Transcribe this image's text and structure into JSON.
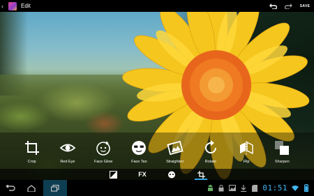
{
  "header": {
    "title": "Edit",
    "save_label": "SAVE"
  },
  "tools": [
    {
      "label": "Crop",
      "icon": "crop-icon"
    },
    {
      "label": "Red Eye",
      "icon": "eye-icon"
    },
    {
      "label": "Face Glow",
      "icon": "face-glow-icon"
    },
    {
      "label": "Face Tan",
      "icon": "face-tan-icon"
    },
    {
      "label": "Straighten",
      "icon": "straighten-icon"
    },
    {
      "label": "Rotate",
      "icon": "rotate-icon"
    },
    {
      "label": "Flip",
      "icon": "flip-icon"
    },
    {
      "label": "Sharpen",
      "icon": "sharpen-icon"
    }
  ],
  "modes": {
    "fx_label": "FX"
  },
  "status": {
    "time": "01:51"
  },
  "colors": {
    "accent": "#3fb7f0",
    "active_tab": "#2ea9e6"
  }
}
